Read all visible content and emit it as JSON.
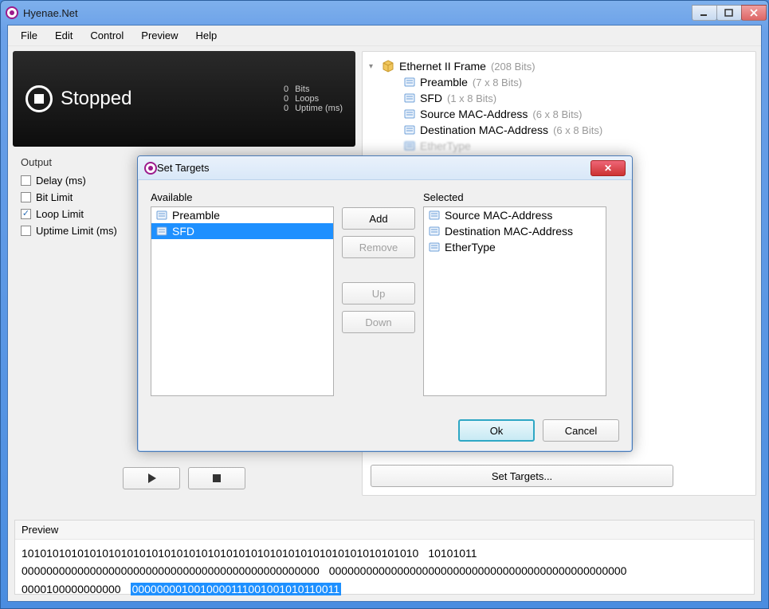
{
  "window": {
    "title": "Hyenae.Net"
  },
  "menu": [
    "File",
    "Edit",
    "Control",
    "Preview",
    "Help"
  ],
  "status": {
    "state": "Stopped",
    "stats": [
      {
        "value": "0",
        "label": "Bits"
      },
      {
        "value": "0",
        "label": "Loops"
      },
      {
        "value": "0",
        "label": "Uptime (ms)"
      }
    ]
  },
  "output": {
    "heading": "Output",
    "options": [
      {
        "label": "Delay (ms)",
        "checked": false
      },
      {
        "label": "Bit Limit",
        "checked": false
      },
      {
        "label": "Loop Limit",
        "checked": true
      },
      {
        "label": "Uptime Limit (ms)",
        "checked": false
      }
    ]
  },
  "tree": {
    "root": {
      "label": "Ethernet II Frame",
      "bits": "(208 Bits)"
    },
    "children": [
      {
        "label": "Preamble",
        "bits": "(7 x 8 Bits)"
      },
      {
        "label": "SFD",
        "bits": "(1 x 8 Bits)"
      },
      {
        "label": "Source MAC-Address",
        "bits": "(6 x 8 Bits)"
      },
      {
        "label": "Destination MAC-Address",
        "bits": "(6 x 8 Bits)"
      },
      {
        "label": "EtherType",
        "bits": ""
      }
    ]
  },
  "set_targets_button": "Set Targets...",
  "preview": {
    "heading": "Preview",
    "lines": [
      [
        {
          "text": "1010101010101010101010101010101010101010101010101010101010101010",
          "hl": false
        },
        {
          "text": "10101011",
          "hl": false
        }
      ],
      [
        {
          "text": "000000000000000000000000000000000000000000000000",
          "hl": false
        },
        {
          "text": "000000000000000000000000000000000000000000000000",
          "hl": false
        }
      ],
      [
        {
          "text": "0000100000000000",
          "hl": false
        },
        {
          "text": "0000000010010000111001001010110011",
          "hl": true
        }
      ]
    ]
  },
  "dialog": {
    "title": "Set Targets",
    "available_label": "Available",
    "selected_label": "Selected",
    "available": [
      {
        "label": "Preamble",
        "selected": false
      },
      {
        "label": "SFD",
        "selected": true
      }
    ],
    "selected": [
      {
        "label": "Source MAC-Address"
      },
      {
        "label": "Destination MAC-Address"
      },
      {
        "label": "EtherType"
      }
    ],
    "buttons": {
      "add": "Add",
      "remove": "Remove",
      "up": "Up",
      "down": "Down",
      "ok": "Ok",
      "cancel": "Cancel"
    }
  }
}
